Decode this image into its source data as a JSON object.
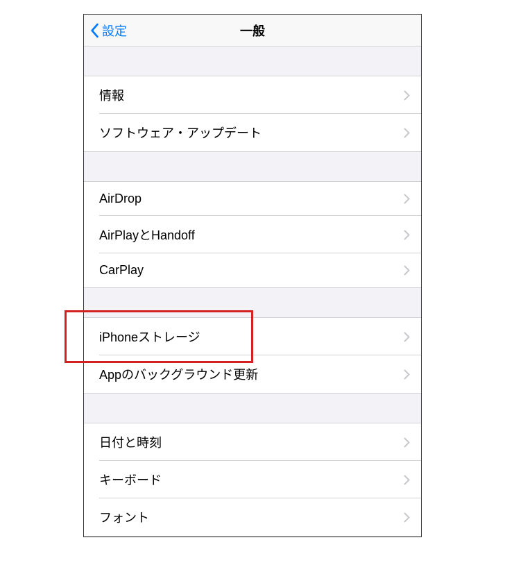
{
  "nav": {
    "back_label": "設定",
    "title": "一般"
  },
  "groups": [
    {
      "items": [
        {
          "label": "情報",
          "name": "about"
        },
        {
          "label": "ソフトウェア・アップデート",
          "name": "software-update"
        }
      ]
    },
    {
      "items": [
        {
          "label": "AirDrop",
          "name": "airdrop"
        },
        {
          "label": "AirPlayとHandoff",
          "name": "airplay-handoff"
        },
        {
          "label": "CarPlay",
          "name": "carplay"
        }
      ]
    },
    {
      "items": [
        {
          "label": "iPhoneストレージ",
          "name": "iphone-storage"
        },
        {
          "label": "Appのバックグラウンド更新",
          "name": "background-app-refresh"
        }
      ]
    },
    {
      "items": [
        {
          "label": "日付と時刻",
          "name": "date-time"
        },
        {
          "label": "キーボード",
          "name": "keyboard"
        },
        {
          "label": "フォント",
          "name": "fonts"
        }
      ]
    }
  ],
  "highlight": {
    "target": "iphone-storage"
  }
}
